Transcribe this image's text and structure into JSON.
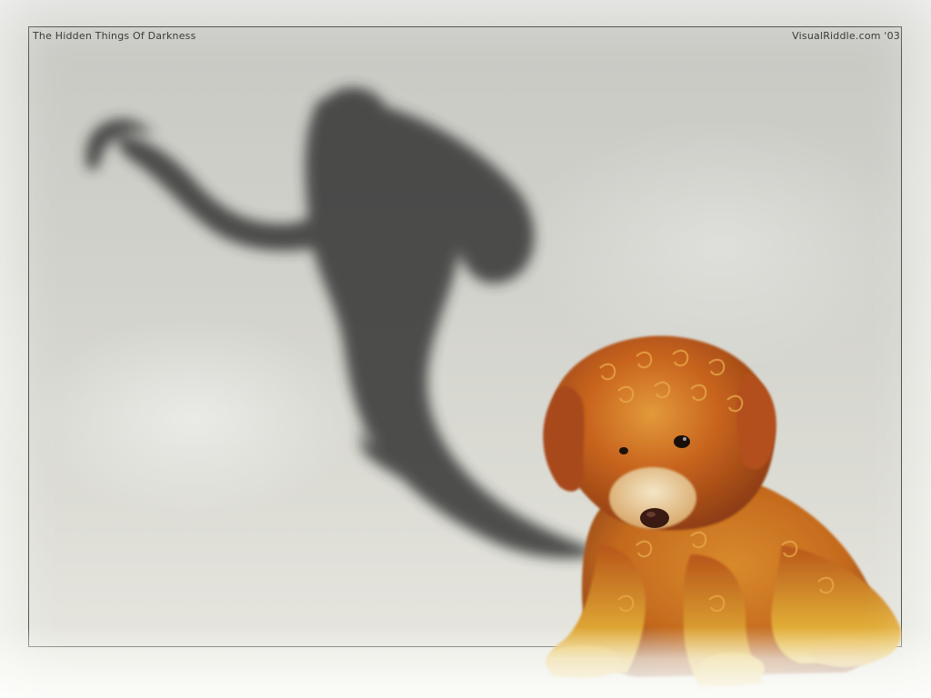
{
  "wallpaper": {
    "title": "The Hidden Things Of Darkness",
    "credit": "VisualRiddle.com '03"
  },
  "colors": {
    "background": "#d6d6d2",
    "frame_border": "#3a3a3a",
    "shadow": "#2e2e2e",
    "puppy_fur": "#c8641e",
    "puppy_highlight": "#e8b43a"
  },
  "scene": {
    "subjects": [
      "puppy",
      "shadow-figure"
    ]
  }
}
